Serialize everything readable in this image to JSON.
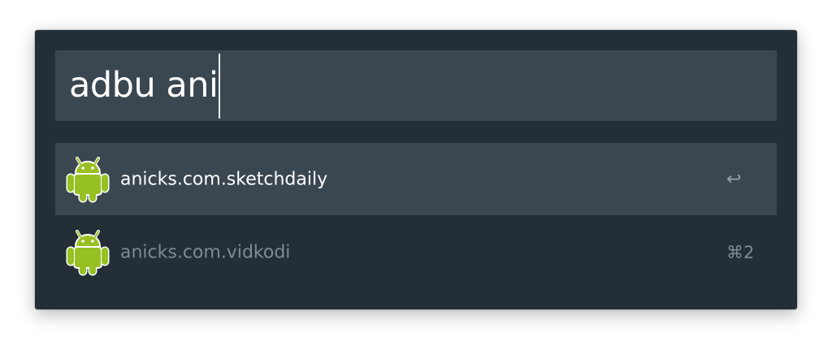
{
  "search": {
    "query": "adbu ani"
  },
  "results": [
    {
      "title": "anicks.com.sketchdaily",
      "icon": "android-icon",
      "shortcut": "↩",
      "selected": true
    },
    {
      "title": "anicks.com.vidkodi",
      "icon": "android-icon",
      "shortcut": "⌘2",
      "selected": false
    }
  ],
  "colors": {
    "window_bg": "#232e37",
    "selected_bg": "#3a4751",
    "android_green": "#97c024"
  }
}
